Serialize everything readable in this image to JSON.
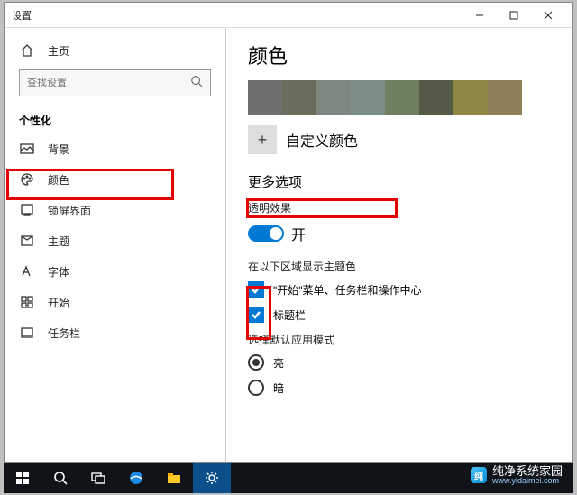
{
  "window": {
    "title": "设置"
  },
  "sidebar": {
    "home": "主页",
    "search_placeholder": "查找设置",
    "section": "个性化",
    "items": [
      {
        "label": "背景"
      },
      {
        "label": "颜色"
      },
      {
        "label": "锁屏界面"
      },
      {
        "label": "主题"
      },
      {
        "label": "字体"
      },
      {
        "label": "开始"
      },
      {
        "label": "任务栏"
      }
    ]
  },
  "content": {
    "heading": "颜色",
    "swatches": [
      "#6f6f6f",
      "#6a6d5a",
      "#7e8880",
      "#7b8f88",
      "#6e7f62",
      "#545a46",
      "#8f8744",
      "#8d7f57"
    ],
    "custom_label": "自定义颜色",
    "more_heading": "更多选项",
    "transparency_label": "透明效果",
    "toggle_on": "开",
    "accent_areas_label": "在以下区域显示主题色",
    "checks": [
      "\"开始\"菜单、任务栏和操作中心",
      "标题栏"
    ],
    "mode_label": "选择默认应用模式",
    "mode_options": [
      "亮",
      "暗"
    ]
  },
  "watermark": {
    "text": "纯净系统家园",
    "url": "www.yidaimei.com"
  }
}
